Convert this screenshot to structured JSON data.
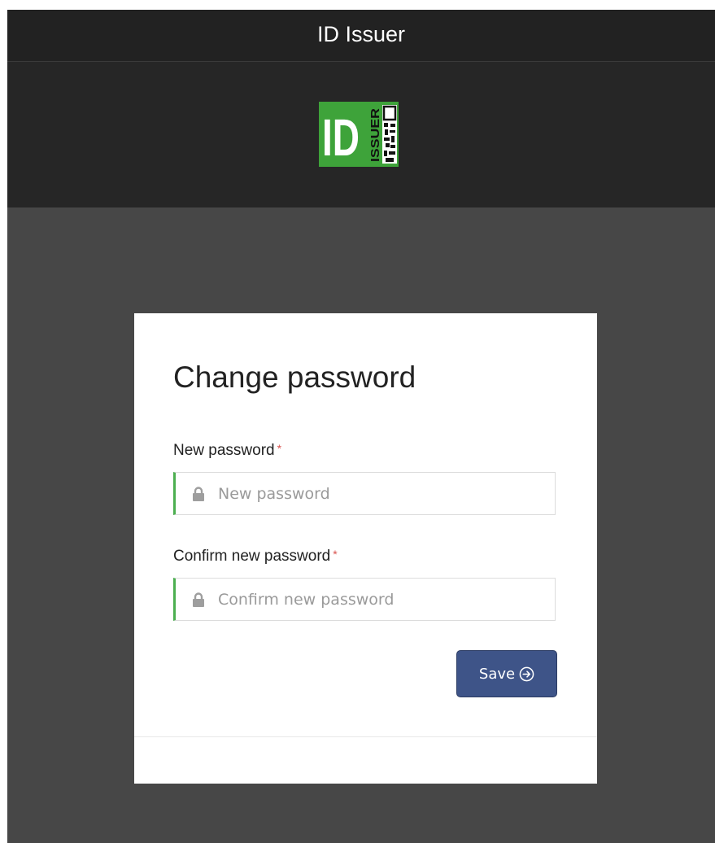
{
  "header": {
    "title": "ID Issuer"
  },
  "logo": {
    "text": "ID",
    "subtext": "ISSUER",
    "icon": "id-issuer-logo",
    "color": "#3ea33a"
  },
  "form": {
    "title": "Change password",
    "required_marker": "*",
    "new_password": {
      "label": "New password",
      "placeholder": "New password",
      "value": "",
      "icon": "lock-icon"
    },
    "confirm_password": {
      "label": "Confirm new password",
      "placeholder": "Confirm new password",
      "value": "",
      "icon": "lock-icon"
    },
    "save_label": "Save",
    "save_icon": "circle-arrow-right-icon"
  },
  "colors": {
    "header_bg": "#222222",
    "logo_band_bg": "#262626",
    "page_bg": "#474747",
    "accent_green": "#4caf50",
    "button_bg": "#3e5488",
    "required": "#d9534f"
  }
}
